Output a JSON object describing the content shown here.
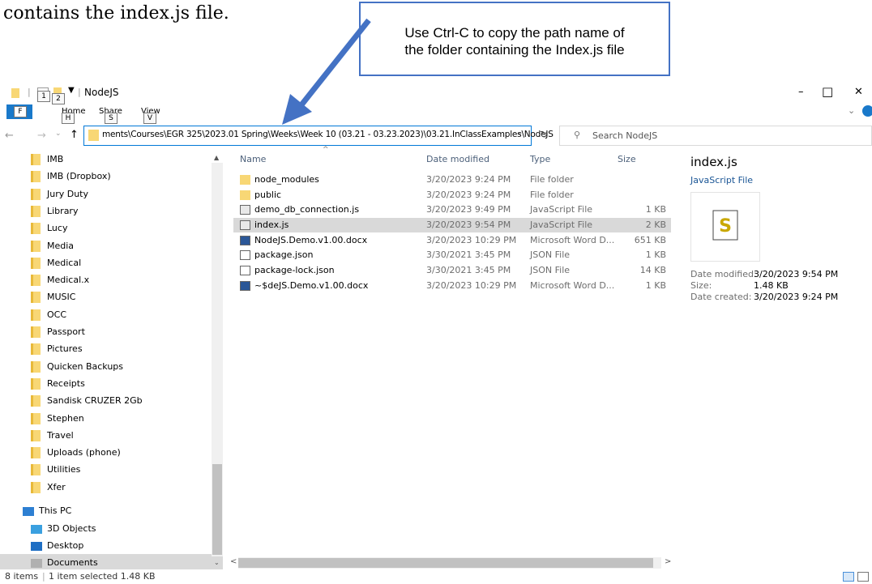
{
  "document": {
    "text": "contains the index.js file.",
    "callout_line1": "Use Ctrl-C to copy the path name of",
    "callout_line2": "the folder containing the Index.js file"
  },
  "window": {
    "title": "NodeJS",
    "qat_key1": "1",
    "qat_key2": "2",
    "minimize": "–",
    "maximize": "□",
    "close": "✕"
  },
  "ribbon": {
    "file_key": "F",
    "tabs": [
      {
        "label": "Home",
        "key": "H"
      },
      {
        "label": "Share",
        "key": "S"
      },
      {
        "label": "View",
        "key": "V"
      }
    ]
  },
  "address": {
    "path": "ments\\Courses\\EGR 325\\2023.01 Spring\\Weeks\\Week 10 (03.21 - 03.23.2023)\\03.21.InClassExamples\\NodeJS",
    "search_placeholder": "Search NodeJS"
  },
  "nav": {
    "folders": [
      "IMB",
      "IMB (Dropbox)",
      "Jury Duty",
      "Library",
      "Lucy",
      "Media",
      "Medical",
      "Medical.x",
      "MUSIC",
      "OCC",
      "Passport",
      "Pictures",
      "Quicken Backups",
      "Receipts",
      "Sandisk CRUZER 2Gb",
      "Stephen",
      "Travel",
      "Uploads (phone)",
      "Utilities",
      "Xfer"
    ],
    "this_pc": "This PC",
    "objects3d": "3D Objects",
    "desktop": "Desktop",
    "documents": "Documents"
  },
  "columns": {
    "name": "Name",
    "date": "Date modified",
    "type": "Type",
    "size": "Size"
  },
  "files": [
    {
      "name": "node_modules",
      "date": "3/20/2023 9:24 PM",
      "type": "File folder",
      "size": "",
      "icon": "folder-icon"
    },
    {
      "name": "public",
      "date": "3/20/2023 9:24 PM",
      "type": "File folder",
      "size": "",
      "icon": "folder-icon"
    },
    {
      "name": "demo_db_connection.js",
      "date": "3/20/2023 9:49 PM",
      "type": "JavaScript File",
      "size": "1 KB",
      "icon": "js-file-icon"
    },
    {
      "name": "index.js",
      "date": "3/20/2023 9:54 PM",
      "type": "JavaScript File",
      "size": "2 KB",
      "icon": "js-file-icon",
      "selected": true
    },
    {
      "name": "NodeJS.Demo.v1.00.docx",
      "date": "3/20/2023 10:29 PM",
      "type": "Microsoft Word D...",
      "size": "651 KB",
      "icon": "word-file-icon"
    },
    {
      "name": "package.json",
      "date": "3/30/2021 3:45 PM",
      "type": "JSON File",
      "size": "1 KB",
      "icon": "json-file-icon"
    },
    {
      "name": "package-lock.json",
      "date": "3/30/2021 3:45 PM",
      "type": "JSON File",
      "size": "14 KB",
      "icon": "json-file-icon"
    },
    {
      "name": "~$deJS.Demo.v1.00.docx",
      "date": "3/20/2023 10:29 PM",
      "type": "Microsoft Word D...",
      "size": "1 KB",
      "icon": "word-file-icon"
    }
  ],
  "preview": {
    "title": "index.js",
    "subtitle": "JavaScript File",
    "modified_label": "Date modified:",
    "modified_value": "3/20/2023 9:54 PM",
    "size_label": "Size:",
    "size_value": "1.48 KB",
    "created_label": "Date created:",
    "created_value": "3/20/2023 9:24 PM"
  },
  "status": {
    "items": "8 items",
    "selection": "1 item selected  1.48 KB"
  },
  "colors": {
    "accent": "#0078d7",
    "callout_border": "#4472c4",
    "folder": "#f8d775"
  }
}
